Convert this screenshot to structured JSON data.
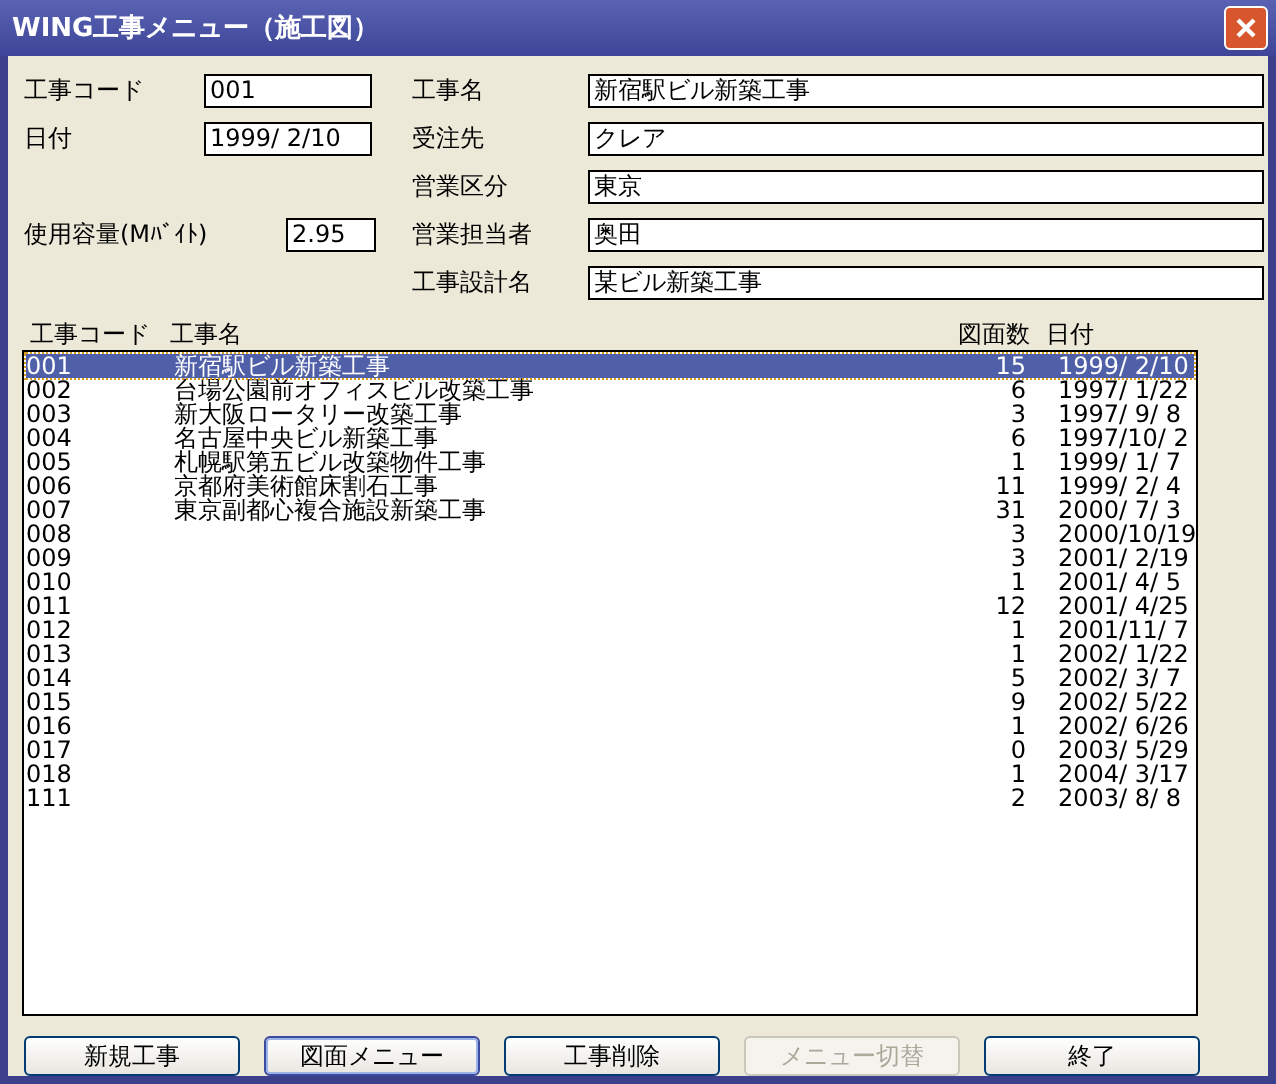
{
  "window": {
    "title": "WING工事メニュー（施工図）"
  },
  "left_fields": [
    {
      "label": "工事コード",
      "value": "001"
    },
    {
      "label": "日付",
      "value": "1999/ 2/10"
    }
  ],
  "capacity": {
    "label": "使用容量(Mﾊﾞｲﾄ)",
    "value": "2.95"
  },
  "right_fields": [
    {
      "label": "工事名",
      "value": "新宿駅ビル新築工事"
    },
    {
      "label": "受注先",
      "value": "クレア"
    },
    {
      "label": "営業区分",
      "value": "東京"
    },
    {
      "label": "営業担当者",
      "value": "奥田"
    },
    {
      "label": "工事設計名",
      "value": "某ビル新築工事"
    }
  ],
  "table": {
    "columns": [
      "工事コード",
      "工事名",
      "図面数",
      "日付"
    ],
    "rows": [
      {
        "code": "001",
        "name": "新宿駅ビル新築工事",
        "count": "15",
        "date": "1999/ 2/10",
        "selected": true
      },
      {
        "code": "002",
        "name": "台場公園前オフィスビル改築工事",
        "count": "6",
        "date": "1997/ 1/22",
        "selected": false
      },
      {
        "code": "003",
        "name": "新大阪ロータリー改築工事",
        "count": "3",
        "date": "1997/ 9/ 8",
        "selected": false
      },
      {
        "code": "004",
        "name": "名古屋中央ビル新築工事",
        "count": "6",
        "date": "1997/10/ 2",
        "selected": false
      },
      {
        "code": "005",
        "name": "札幌駅第五ビル改築物件工事",
        "count": "1",
        "date": "1999/ 1/ 7",
        "selected": false
      },
      {
        "code": "006",
        "name": "京都府美術館床割石工事",
        "count": "11",
        "date": "1999/ 2/ 4",
        "selected": false
      },
      {
        "code": "007",
        "name": "東京副都心複合施設新築工事",
        "count": "31",
        "date": "2000/ 7/ 3",
        "selected": false
      },
      {
        "code": "008",
        "count": "3",
        "date": "2000/10/19",
        "selected": false
      },
      {
        "code": "009",
        "count": "3",
        "date": "2001/ 2/19",
        "selected": false
      },
      {
        "code": "010",
        "count": "1",
        "date": "2001/ 4/ 5",
        "selected": false
      },
      {
        "code": "011",
        "count": "12",
        "date": "2001/ 4/25",
        "selected": false
      },
      {
        "code": "012",
        "count": "1",
        "date": "2001/11/ 7",
        "selected": false
      },
      {
        "code": "013",
        "count": "1",
        "date": "2002/ 1/22",
        "selected": false
      },
      {
        "code": "014",
        "count": "5",
        "date": "2002/ 3/ 7",
        "selected": false
      },
      {
        "code": "015",
        "count": "9",
        "date": "2002/ 5/22",
        "selected": false
      },
      {
        "code": "016",
        "count": "1",
        "date": "2002/ 6/26",
        "selected": false
      },
      {
        "code": "017",
        "count": "0",
        "date": "2003/ 5/29",
        "selected": false
      },
      {
        "code": "018",
        "count": "1",
        "date": "2004/ 3/17",
        "selected": false
      },
      {
        "code": "111",
        "count": "2",
        "date": "2003/ 8/ 8",
        "selected": false
      }
    ]
  },
  "buttons": [
    {
      "label": "新規工事",
      "disabled": false,
      "focused": false
    },
    {
      "label": "図面メニュー",
      "disabled": false,
      "focused": true
    },
    {
      "label": "工事削除",
      "disabled": false,
      "focused": false
    },
    {
      "label": "メニュー切替",
      "disabled": true,
      "focused": false
    },
    {
      "label": "終了",
      "disabled": false,
      "focused": false
    }
  ]
}
